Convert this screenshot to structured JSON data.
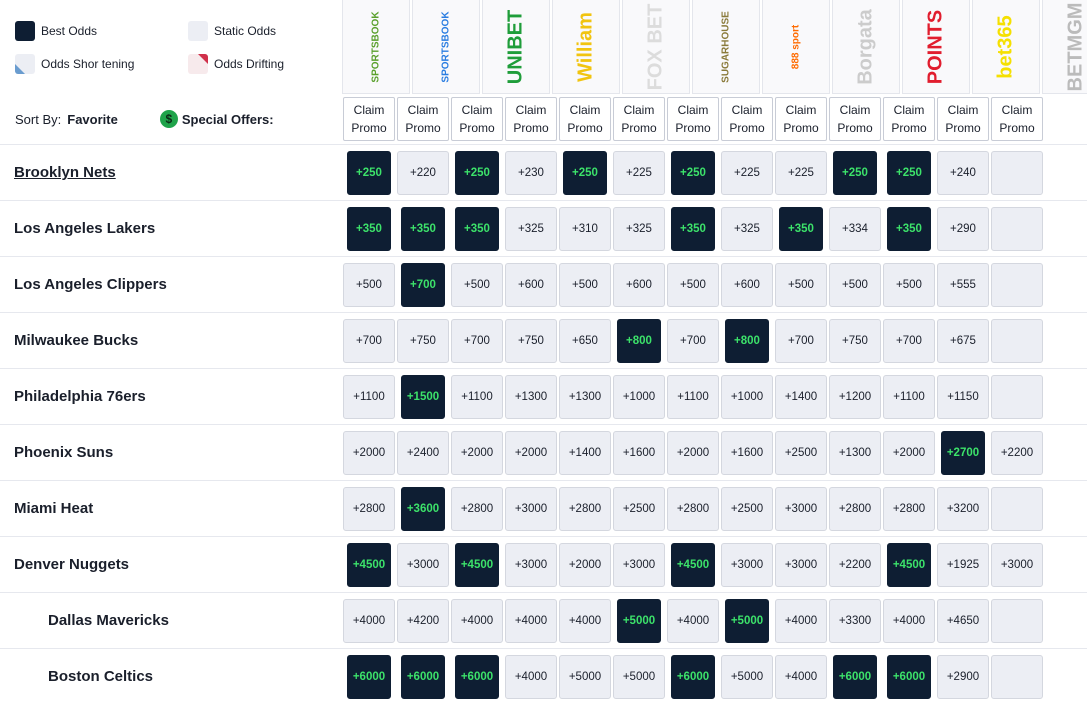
{
  "legend": {
    "best": "Best Odds",
    "static": "Static Odds",
    "shortening": "Odds Shor tening",
    "drifting": "Odds Drifting"
  },
  "books": [
    {
      "name": "SPORTSBOOK",
      "color": "#5aa02c"
    },
    {
      "name": "SPORTSBOOK",
      "color": "#2a7de1"
    },
    {
      "name": "UNIBET",
      "color": "#1f9d3a"
    },
    {
      "name": "William",
      "color": "#f1c40f"
    },
    {
      "name": "FOX BET",
      "color": "#dcdcdc"
    },
    {
      "name": "SUGARHOUSE",
      "color": "#8a7a3a"
    },
    {
      "name": "888 sport",
      "color": "#ff6b00"
    },
    {
      "name": "Borgata",
      "color": "#cccccc"
    },
    {
      "name": "POINTS",
      "color": "#e11d2e"
    },
    {
      "name": "bet365",
      "color": "#f5e000"
    },
    {
      "name": "BETMGM",
      "color": "#bbbbbb"
    }
  ],
  "sort": {
    "label": "Sort By:",
    "value": "Favorite",
    "offers_label": "Special Offers:",
    "offers_icon": "$"
  },
  "promo": {
    "line1": "Claim",
    "line2": "Promo"
  },
  "teams": [
    {
      "name": "Brooklyn Nets",
      "link": true,
      "indent": false,
      "odds": [
        "+250",
        "+220",
        "+250",
        "+230",
        "+250",
        "+225",
        "+250",
        "+225",
        "+225",
        "+250",
        "+250",
        "+240",
        ""
      ],
      "best": [
        0,
        2,
        4,
        6,
        9,
        10
      ]
    },
    {
      "name": "Los Angeles Lakers",
      "link": false,
      "indent": false,
      "odds": [
        "+350",
        "+350",
        "+350",
        "+325",
        "+310",
        "+325",
        "+350",
        "+325",
        "+350",
        "+334",
        "+350",
        "+290",
        ""
      ],
      "best": [
        0,
        1,
        2,
        6,
        8,
        10
      ]
    },
    {
      "name": "Los Angeles Clippers",
      "link": false,
      "indent": false,
      "odds": [
        "+500",
        "+700",
        "+500",
        "+600",
        "+500",
        "+600",
        "+500",
        "+600",
        "+500",
        "+500",
        "+500",
        "+555",
        ""
      ],
      "best": [
        1
      ]
    },
    {
      "name": "Milwaukee Bucks",
      "link": false,
      "indent": false,
      "odds": [
        "+700",
        "+750",
        "+700",
        "+750",
        "+650",
        "+800",
        "+700",
        "+800",
        "+700",
        "+750",
        "+700",
        "+675",
        ""
      ],
      "best": [
        5,
        7
      ]
    },
    {
      "name": "Philadelphia 76ers",
      "link": false,
      "indent": false,
      "odds": [
        "+1100",
        "+1500",
        "+1100",
        "+1300",
        "+1300",
        "+1000",
        "+1100",
        "+1000",
        "+1400",
        "+1200",
        "+1100",
        "+1150",
        ""
      ],
      "best": [
        1
      ]
    },
    {
      "name": "Phoenix Suns",
      "link": false,
      "indent": false,
      "odds": [
        "+2000",
        "+2400",
        "+2000",
        "+2000",
        "+1400",
        "+1600",
        "+2000",
        "+1600",
        "+2500",
        "+1300",
        "+2000",
        "+2700",
        "+2200"
      ],
      "best": [
        11
      ]
    },
    {
      "name": "Miami Heat",
      "link": false,
      "indent": false,
      "odds": [
        "+2800",
        "+3600",
        "+2800",
        "+3000",
        "+2800",
        "+2500",
        "+2800",
        "+2500",
        "+3000",
        "+2800",
        "+2800",
        "+3200",
        ""
      ],
      "best": [
        1
      ]
    },
    {
      "name": "Denver Nuggets",
      "link": false,
      "indent": false,
      "odds": [
        "+4500",
        "+3000",
        "+4500",
        "+3000",
        "+2000",
        "+3000",
        "+4500",
        "+3000",
        "+3000",
        "+2200",
        "+4500",
        "+1925",
        "+3000"
      ],
      "best": [
        0,
        2,
        6,
        10
      ]
    },
    {
      "name": "Dallas Mavericks",
      "link": false,
      "indent": true,
      "odds": [
        "+4000",
        "+4200",
        "+4000",
        "+4000",
        "+4000",
        "+5000",
        "+4000",
        "+5000",
        "+4000",
        "+3300",
        "+4000",
        "+4650",
        ""
      ],
      "best": [
        5,
        7
      ]
    },
    {
      "name": "Boston Celtics",
      "link": false,
      "indent": true,
      "odds": [
        "+6000",
        "+6000",
        "+6000",
        "+4000",
        "+5000",
        "+5000",
        "+6000",
        "+5000",
        "+4000",
        "+6000",
        "+6000",
        "+2900",
        ""
      ],
      "best": [
        0,
        1,
        2,
        6,
        9,
        10
      ]
    }
  ]
}
